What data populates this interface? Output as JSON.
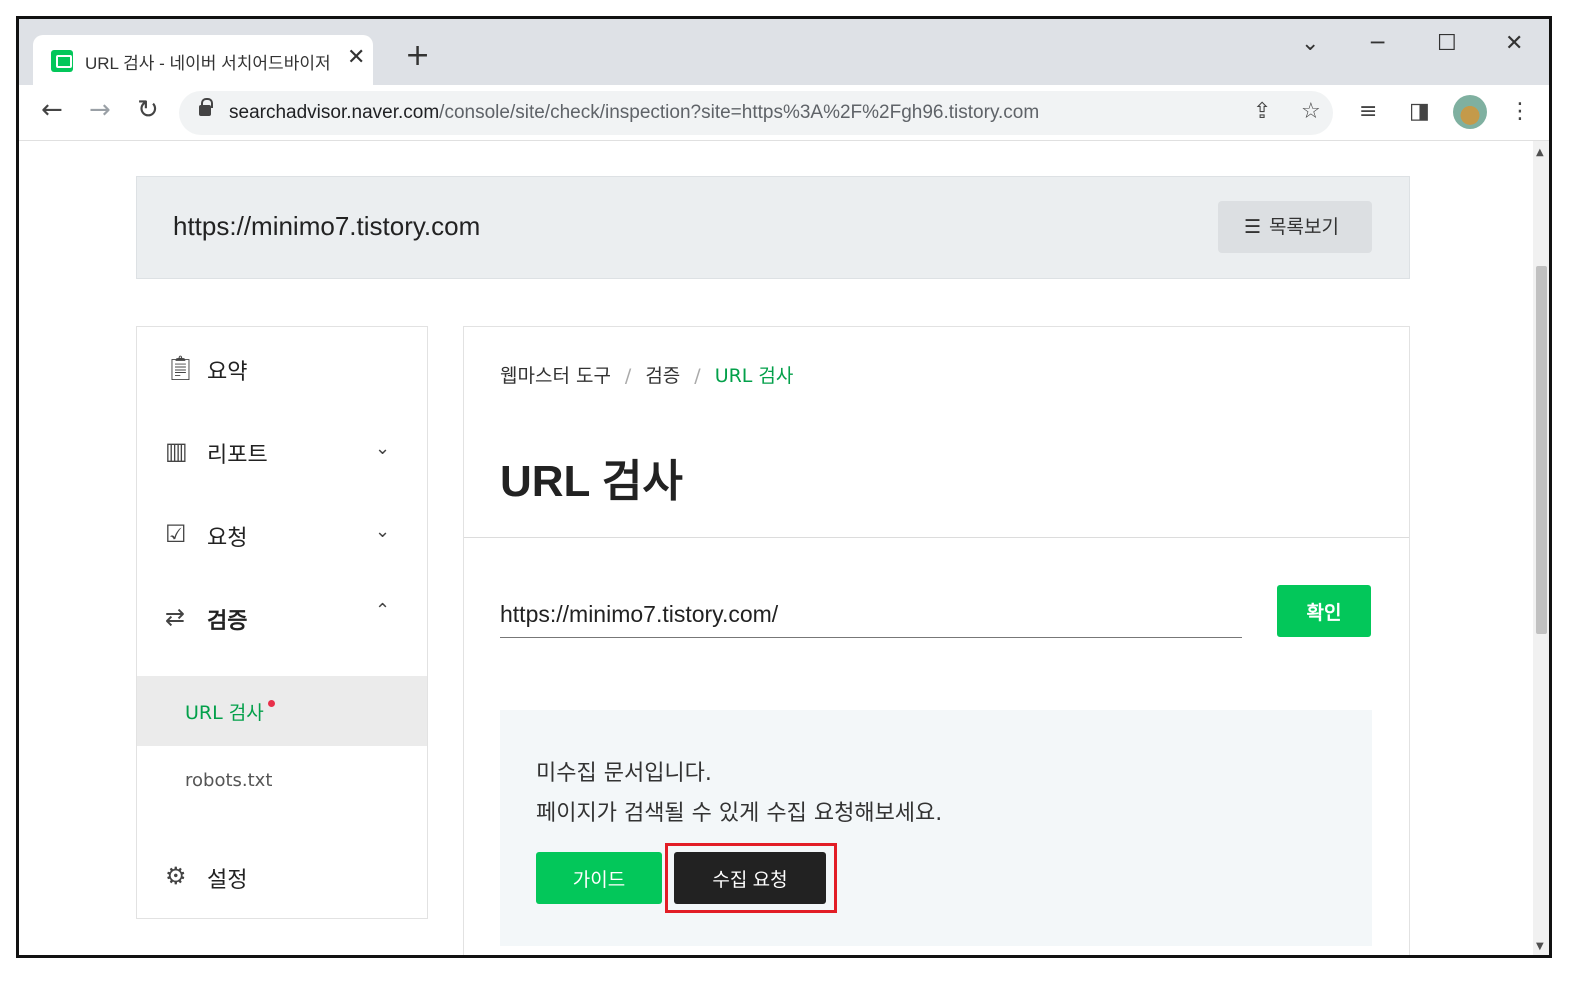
{
  "browser": {
    "tab_title": "URL 검사 - 네이버 서치어드바이저",
    "tab_close": "✕",
    "new_tab": "+",
    "url_host": "searchadvisor.naver.com",
    "url_path": "/console/site/check/inspection?site=https%3A%2F%2Fgh96.tistory.com"
  },
  "site": {
    "url": "https://minimo7.tistory.com",
    "list_button": "목록보기"
  },
  "sidebar": {
    "items": [
      {
        "label": "요약",
        "icon": "clipboard-icon"
      },
      {
        "label": "리포트",
        "icon": "chart-icon",
        "expanded": false
      },
      {
        "label": "요청",
        "icon": "checklist-icon",
        "expanded": false
      },
      {
        "label": "검증",
        "icon": "swap-arrows-icon",
        "expanded": true
      },
      {
        "label": "설정",
        "icon": "gear-icon"
      }
    ],
    "subitems": [
      {
        "label": "URL 검사",
        "active": true,
        "has_dot": true
      },
      {
        "label": "robots.txt",
        "active": false
      }
    ]
  },
  "main": {
    "breadcrumb": [
      "웹마스터 도구",
      "검증",
      "URL 검사"
    ],
    "breadcrumb_sep": "/",
    "title": "URL 검사",
    "input_value": "https://minimo7.tistory.com/",
    "confirm_button": "확인",
    "notice_line1": "미수집 문서입니다.",
    "notice_line2": "페이지가 검색될 수 있게 수집 요청해보세요.",
    "guide_button": "가이드",
    "collect_button": "수집 요청"
  },
  "colors": {
    "accent_green": "#03c75a",
    "highlight_red": "#e21e26",
    "dark_button": "#222222"
  }
}
